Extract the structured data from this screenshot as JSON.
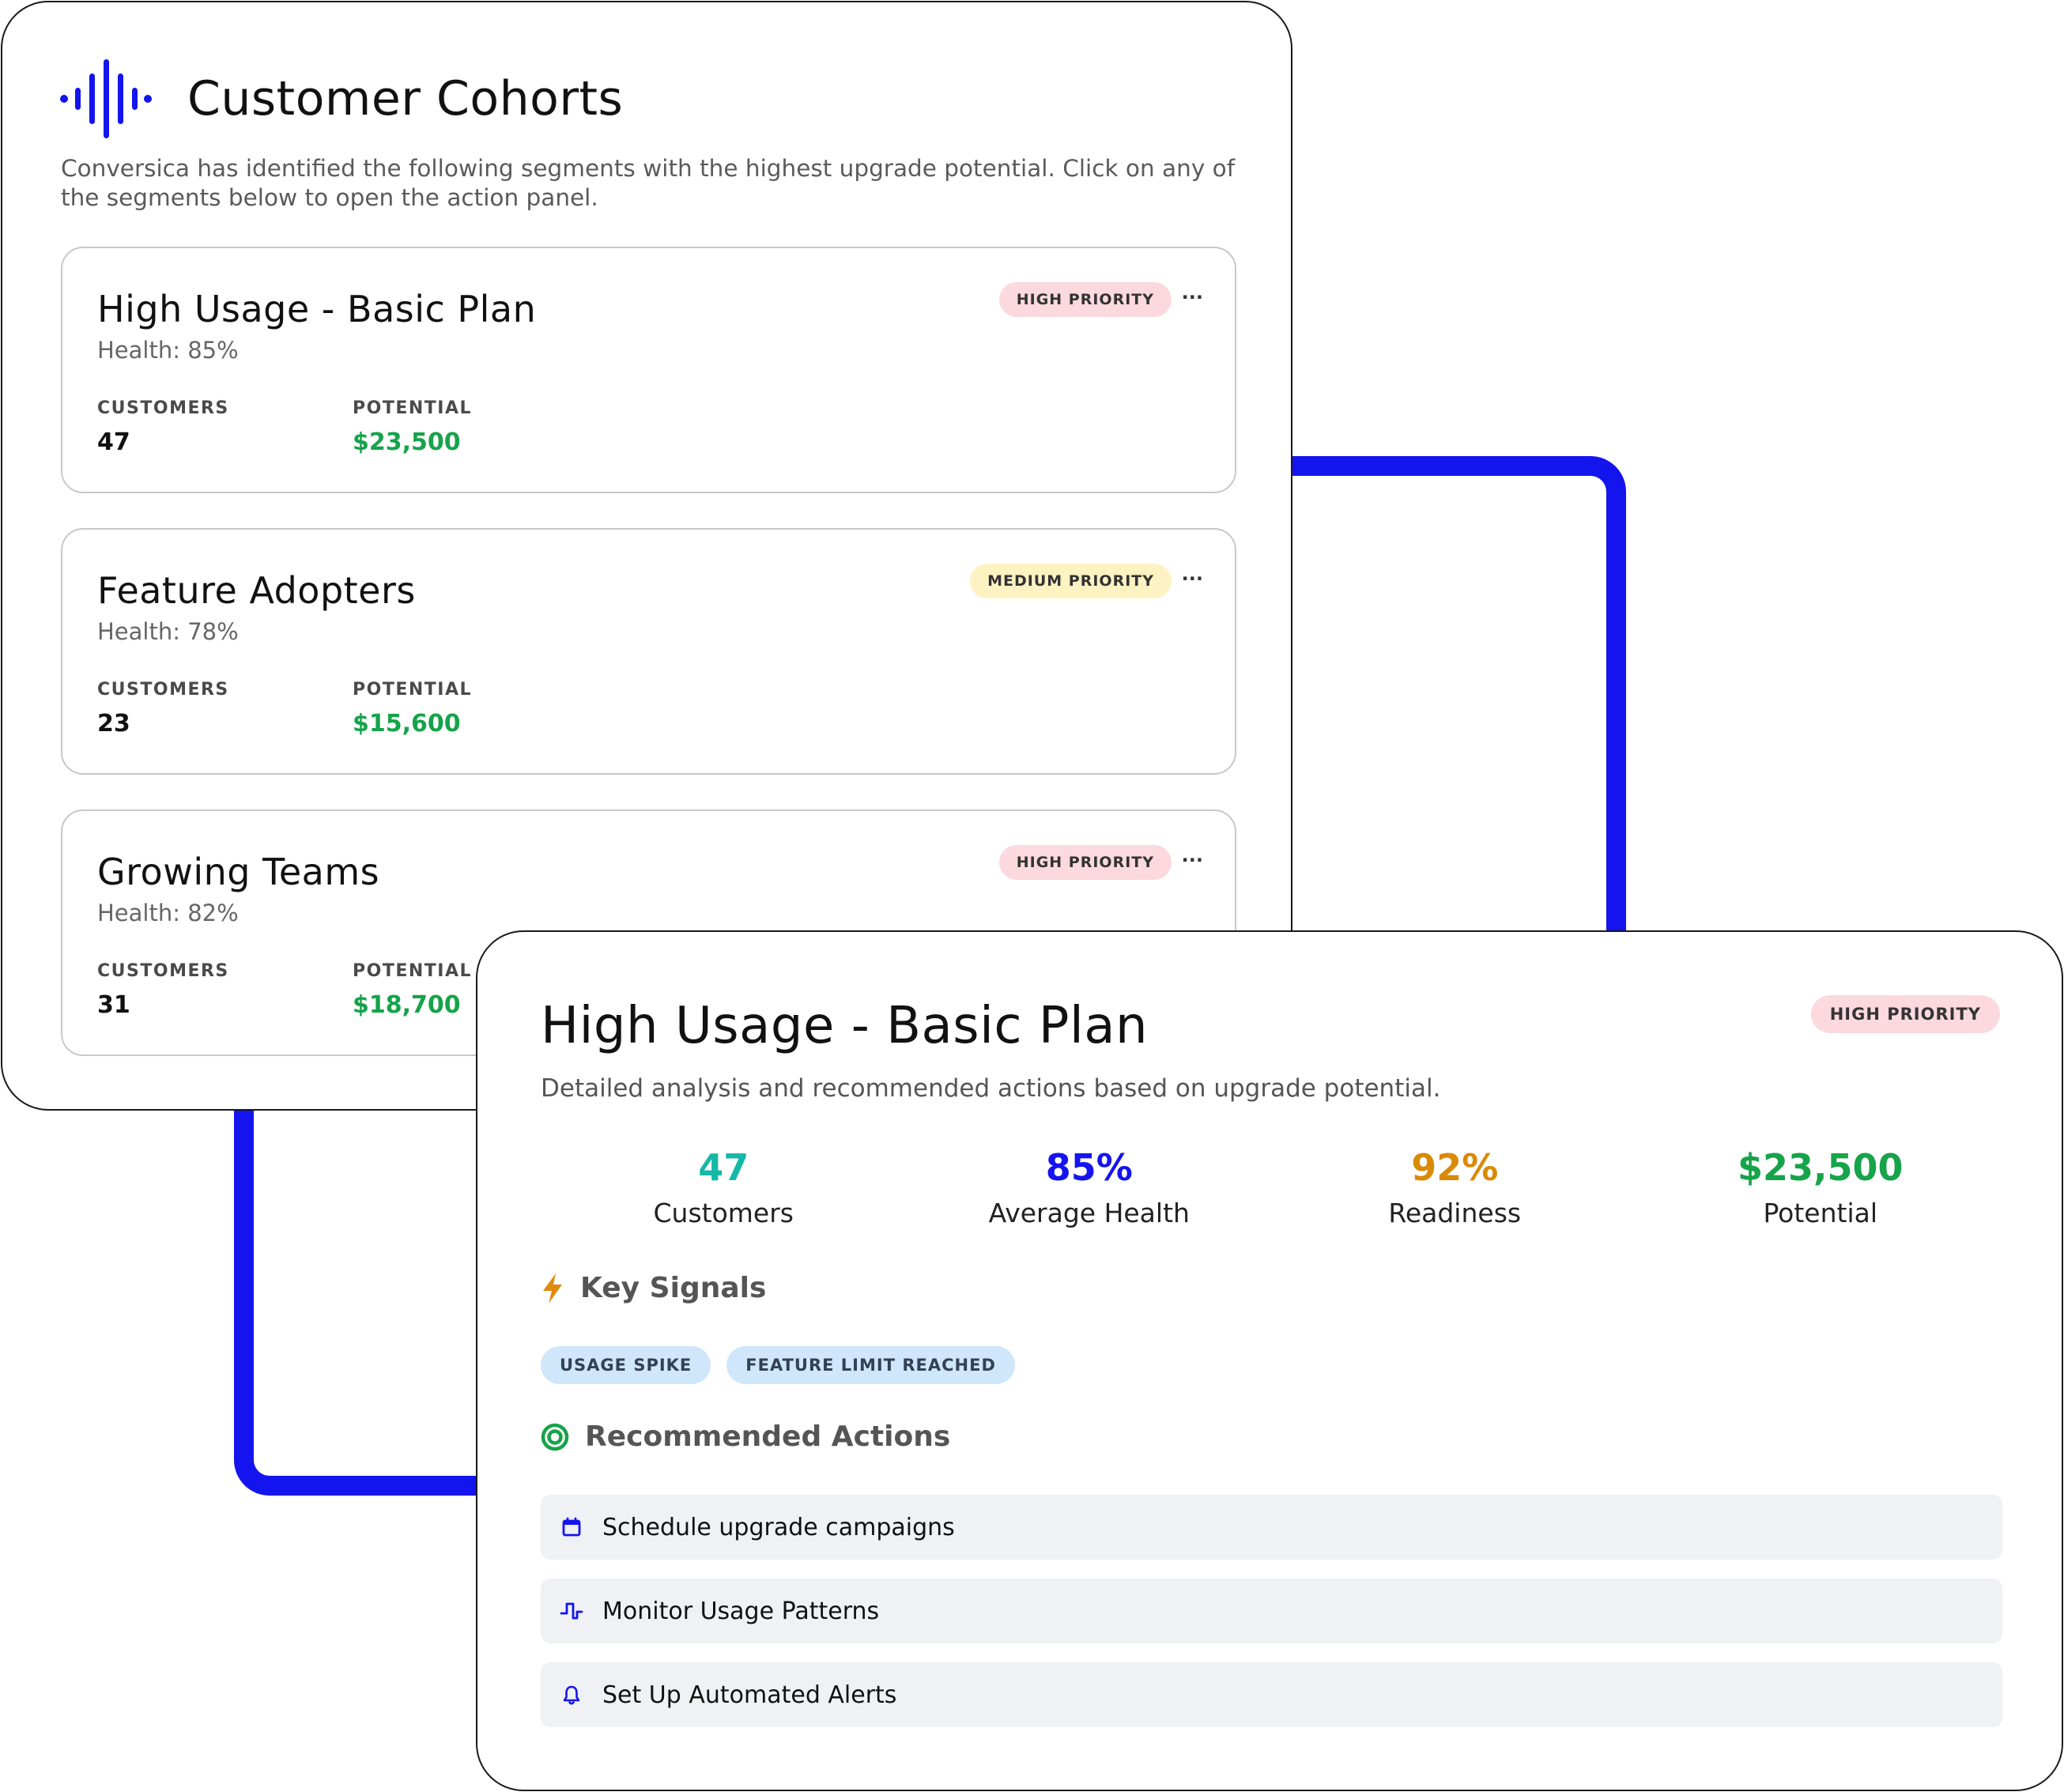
{
  "cohorts_panel": {
    "title": "Customer Cohorts",
    "description": "Conversica has identified the following segments with the highest upgrade potential. Click on any of the segments below to open the action panel.",
    "cards": [
      {
        "name": "High Usage - Basic Plan",
        "health": "Health: 85%",
        "priority": "HIGH PRIORITY",
        "customers_label": "CUSTOMERS",
        "customers": "47",
        "potential_label": "POTENTIAL",
        "potential": "$23,500"
      },
      {
        "name": "Feature Adopters",
        "health": "Health: 78%",
        "priority": "MEDIUM PRIORITY",
        "customers_label": "CUSTOMERS",
        "customers": "23",
        "potential_label": "POTENTIAL",
        "potential": "$15,600"
      },
      {
        "name": "Growing Teams",
        "health": "Health: 82%",
        "priority": "HIGH PRIORITY",
        "customers_label": "CUSTOMERS",
        "customers": "31",
        "potential_label": "POTENTIAL",
        "potential": "$18,700"
      }
    ],
    "more_icon": "more-horizontal-icon",
    "more_glyph": "···"
  },
  "detail_panel": {
    "title": "High Usage - Basic Plan",
    "priority": "HIGH PRIORITY",
    "description": "Detailed analysis and recommended actions based on upgrade potential.",
    "metrics": [
      {
        "value": "47",
        "label": "Customers",
        "color": "#14b8a6"
      },
      {
        "value": "85%",
        "label": "Average Health",
        "color": "#1414ee"
      },
      {
        "value": "92%",
        "label": "Readiness",
        "color": "#d98a06"
      },
      {
        "value": "$23,500",
        "label": "Potential",
        "color": "#16a34a"
      }
    ],
    "key_signals": {
      "heading": "Key Signals",
      "icon": "lightning-bolt-icon",
      "chips": [
        "USAGE SPIKE",
        "FEATURE LIMIT REACHED"
      ]
    },
    "recommended_actions": {
      "heading": "Recommended Actions",
      "icon": "target-icon",
      "items": [
        {
          "label": "Schedule upgrade campaigns",
          "icon": "calendar-icon"
        },
        {
          "label": "Monitor Usage Patterns",
          "icon": "pulse-icon"
        },
        {
          "label": "Set Up Automated Alerts",
          "icon": "bell-icon"
        }
      ]
    }
  },
  "colors": {
    "accent_blue": "#1414ee",
    "high_priority_bg": "#fbd9df",
    "medium_priority_bg": "#fdf2c2",
    "signal_chip_bg": "#cfe6fb",
    "positive_green": "#16a34a"
  }
}
